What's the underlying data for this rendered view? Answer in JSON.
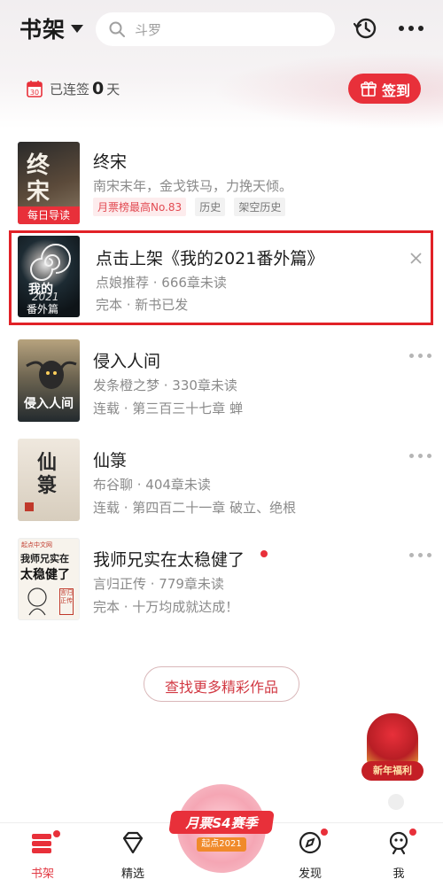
{
  "header": {
    "title": "书架",
    "search_placeholder": "斗罗"
  },
  "streak": {
    "calendar_day": "30",
    "prefix": "已连签",
    "days": "0",
    "suffix": "天",
    "signin_label": "签到"
  },
  "books": [
    {
      "title": "终宋",
      "line1": "南宋末年，金戈铁马，力挽天倾。",
      "tags": [
        "月票榜最高No.83",
        "历史",
        "架空历史"
      ],
      "cover_text": "终宋",
      "cover_badge": "每日导读"
    },
    {
      "title": "点击上架《我的2021番外篇》",
      "line1": "点娘推荐 · 666章未读",
      "line2": "完本 · 新书已发",
      "cover_text1": "我的",
      "cover_text2": "2021",
      "cover_text3": "番外篇"
    },
    {
      "title": "侵入人间",
      "line1": "发条橙之梦 · 330章未读",
      "line2": "连载 · 第三百三十七章 蝉",
      "cover_text": "侵入人间"
    },
    {
      "title": "仙箓",
      "line1": "布谷聊 · 404章未读",
      "line2": "连载 · 第四百二十一章 破立、绝根",
      "cover_text": "仙箓"
    },
    {
      "title": "我师兄实在太稳健了",
      "line1": "言归正传 · 779章未读",
      "line2": "完本 · 十万均成就达成！",
      "cover_text1": "我师兄实在",
      "cover_text2": "太稳健了",
      "cover_publisher": "起点中文网",
      "cover_author": "言归正传"
    }
  ],
  "more_button": "查找更多精彩作品",
  "promos": {
    "center_line1": "月票S4赛季",
    "center_line2": "起点2021",
    "side_label": "新年福利"
  },
  "nav": [
    {
      "label": "书架",
      "icon": "bookshelf-icon",
      "active": true
    },
    {
      "label": "精选",
      "icon": "diamond-icon",
      "active": false
    },
    {
      "label": "发现",
      "icon": "compass-icon",
      "active": false
    },
    {
      "label": "我",
      "icon": "profile-icon",
      "active": false
    }
  ],
  "colors": {
    "accent": "#e8303a",
    "highlight_border": "#e12127"
  }
}
